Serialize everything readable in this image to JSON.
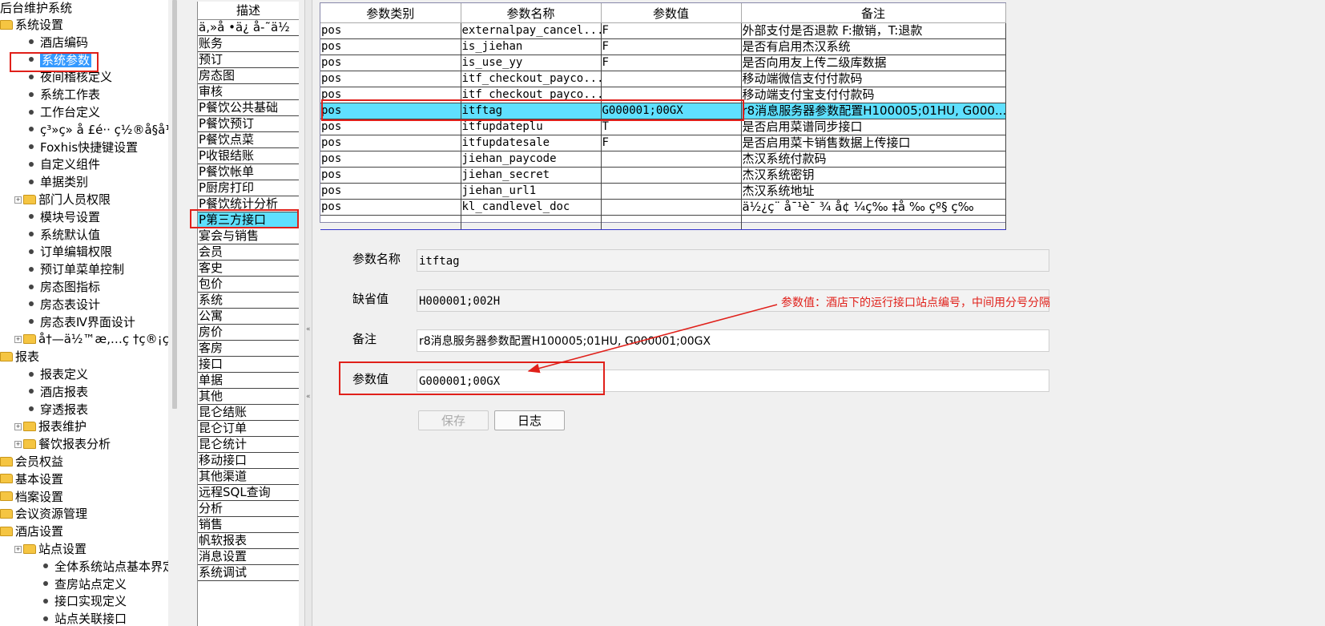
{
  "tree": {
    "title": "后台维护系统",
    "nodes": [
      {
        "label": "系统设置",
        "kind": "folder",
        "level": 0
      },
      {
        "label": "酒店编码",
        "kind": "leaf",
        "level": 1
      },
      {
        "label": "系统参数",
        "kind": "leaf",
        "level": 1,
        "selected": true
      },
      {
        "label": "夜间稽核定义",
        "kind": "leaf",
        "level": 1
      },
      {
        "label": "系统工作表",
        "kind": "leaf",
        "level": 1
      },
      {
        "label": "工作台定义",
        "kind": "leaf",
        "level": 1
      },
      {
        "label": "ç³»ç» å  £é··  ç½®å§å¹",
        "kind": "leaf",
        "level": 1
      },
      {
        "label": "Foxhis快捷键设置",
        "kind": "leaf",
        "level": 1
      },
      {
        "label": "自定义组件",
        "kind": "leaf",
        "level": 1
      },
      {
        "label": "单据类别",
        "kind": "leaf",
        "level": 1
      },
      {
        "label": "部门人员权限",
        "kind": "folder",
        "level": 1,
        "expander": true
      },
      {
        "label": "模块号设置",
        "kind": "leaf",
        "level": 1
      },
      {
        "label": "系统默认值",
        "kind": "leaf",
        "level": 1
      },
      {
        "label": "订单编辑权限",
        "kind": "leaf",
        "level": 1
      },
      {
        "label": "预订单菜单控制",
        "kind": "leaf",
        "level": 1
      },
      {
        "label": "房态图指标",
        "kind": "leaf",
        "level": 1
      },
      {
        "label": "房态表设计",
        "kind": "leaf",
        "level": 1
      },
      {
        "label": "房态表Ⅳ界面设计",
        "kind": "leaf",
        "level": 1
      },
      {
        "label": "å†—ä½™æ‚…ç  †ç®¡ç  †",
        "kind": "folder",
        "level": 1,
        "expander": true
      },
      {
        "label": "报表",
        "kind": "folder",
        "level": 0
      },
      {
        "label": "报表定义",
        "kind": "leaf",
        "level": 1
      },
      {
        "label": "酒店报表",
        "kind": "leaf",
        "level": 1
      },
      {
        "label": "穿透报表",
        "kind": "leaf",
        "level": 1
      },
      {
        "label": "报表维护",
        "kind": "folder",
        "level": 1,
        "expander": true
      },
      {
        "label": "餐饮报表分析",
        "kind": "folder",
        "level": 1,
        "expander": true
      },
      {
        "label": "会员权益",
        "kind": "folder",
        "level": 0
      },
      {
        "label": "基本设置",
        "kind": "folder",
        "level": 0
      },
      {
        "label": "档案设置",
        "kind": "folder",
        "level": 0
      },
      {
        "label": "会议资源管理",
        "kind": "folder",
        "level": 0
      },
      {
        "label": "酒店设置",
        "kind": "folder",
        "level": 0
      },
      {
        "label": "站点设置",
        "kind": "folder",
        "level": 1,
        "expander": true
      },
      {
        "label": "全体系统站点基本界定",
        "kind": "leaf",
        "level": 2
      },
      {
        "label": "查房站点定义",
        "kind": "leaf",
        "level": 2
      },
      {
        "label": "接口实现定义",
        "kind": "leaf",
        "level": 2
      },
      {
        "label": "站点关联接口",
        "kind": "leaf",
        "level": 2
      }
    ]
  },
  "desc_list": {
    "header": "描述",
    "items": [
      "ä,»å  •ä¿  å-˜ä½",
      "账务",
      "预订",
      "房态图",
      "审核",
      "P餐饮公共基础",
      "P餐饮预订",
      "P餐饮点菜",
      "P收银结账",
      "P餐饮帐单",
      "P厨房打印",
      "P餐饮统计分析",
      "P第三方接口",
      "宴会与销售",
      "会员",
      "客史",
      "包价",
      "系统",
      "公寓",
      "房价",
      "客房",
      "接口",
      "单据",
      "其他",
      "昆仑结账",
      "昆仑订单",
      "昆仑统计",
      "移动接口",
      "其他渠道",
      "远程SQL查询",
      "分析",
      "销售",
      "帆软报表",
      "消息设置",
      "系统调试"
    ],
    "active_index": 12
  },
  "grid": {
    "columns": [
      "参数类别",
      "参数名称",
      "参数值",
      "备注"
    ],
    "rows": [
      [
        "pos",
        "externalpay_cancel...",
        "F",
        "外部支付是否退款  F:撤销，T:退款"
      ],
      [
        "pos",
        "is_jiehan",
        "F",
        "是否有启用杰汉系统"
      ],
      [
        "pos",
        "is_use_yy",
        "F",
        "是否向用友上传二级库数据"
      ],
      [
        "pos",
        "itf_checkout_payco...",
        "",
        "移动端微信支付付款码"
      ],
      [
        "pos",
        "itf_checkout_payco...",
        "",
        "移动端支付宝支付付款码"
      ],
      [
        "pos",
        "itftag",
        "G000001;00GX",
        "r8消息服务器参数配置H100005;01HU, G000..."
      ],
      [
        "pos",
        "itfupdateplu",
        "T",
        "是否启用菜谱同步接口"
      ],
      [
        "pos",
        "itfupdatesale",
        "F",
        "是否启用菜卡销售数据上传接口"
      ],
      [
        "pos",
        "jiehan_paycode",
        "",
        "杰汉系统付款码"
      ],
      [
        "pos",
        "jiehan_secret",
        "",
        "杰汉系统密钥"
      ],
      [
        "pos",
        "jiehan_url1",
        "",
        "杰汉系统地址"
      ],
      [
        "pos",
        "kl_candlevel_doc",
        "",
        "ä½¿ç¨ å¯¹è¯ ¾ å¢ ¼ç‰ ‡å ‰ çº§ ç­‰"
      ]
    ],
    "active_index": 5
  },
  "form": {
    "param_name_label": "参数名称",
    "param_name_value": "itftag",
    "default_label": "缺省值",
    "default_value": "H000001;002H",
    "remark_label": "备注",
    "remark_value": "r8消息服务器参数配置H100005;01HU, G000001;00GX",
    "param_value_label": "参数值",
    "param_value_value": "G000001;00GX",
    "save_button": "保存",
    "log_button": "日志"
  },
  "annotation": {
    "note": "参数值：酒店下的运行接口站点编号，中间用分号分隔",
    "color": "#e0201a"
  }
}
